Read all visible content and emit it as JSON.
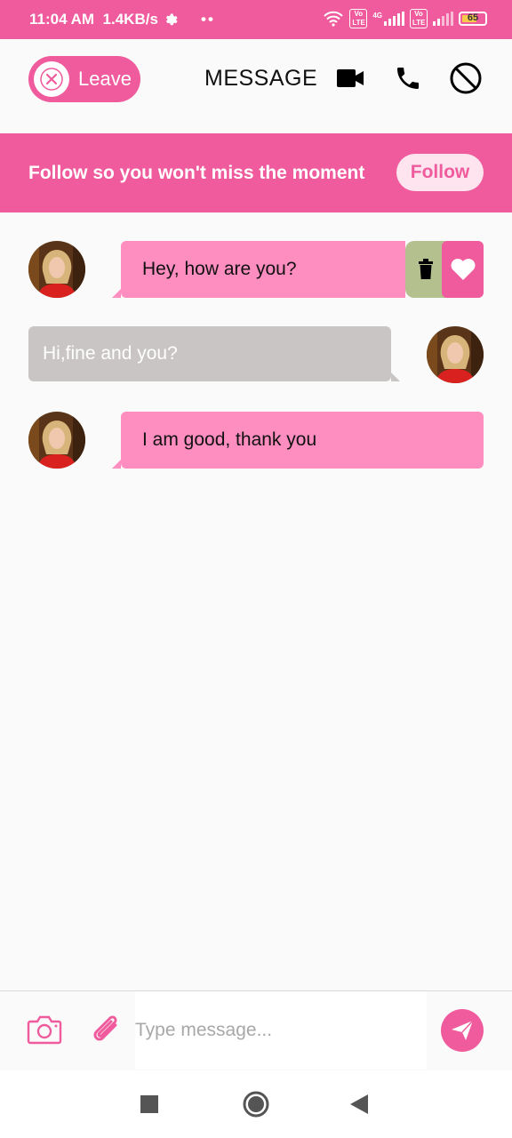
{
  "status": {
    "time": "11:04 AM",
    "speed": "1.4KB/s",
    "dots": "••",
    "battery": "65",
    "volte1": "Vo LTE",
    "net": "4G",
    "volte2": "Vo LTE"
  },
  "header": {
    "leave_label": "Leave",
    "title": "MESSAGE"
  },
  "banner": {
    "text": "Follow so you won't miss the moment",
    "follow_label": "Follow"
  },
  "messages": [
    {
      "side": "left",
      "text": "Hey, how are you?"
    },
    {
      "side": "right",
      "text": "Hi,fine and you?"
    },
    {
      "side": "left",
      "text": "I am good, thank you"
    }
  ],
  "composer": {
    "placeholder": "Type message..."
  },
  "colors": {
    "accent": "#ef5b9c",
    "bubble_in": "#fe8dc0",
    "bubble_out": "#c8c5c4",
    "delete_bg": "#b4c08e"
  }
}
